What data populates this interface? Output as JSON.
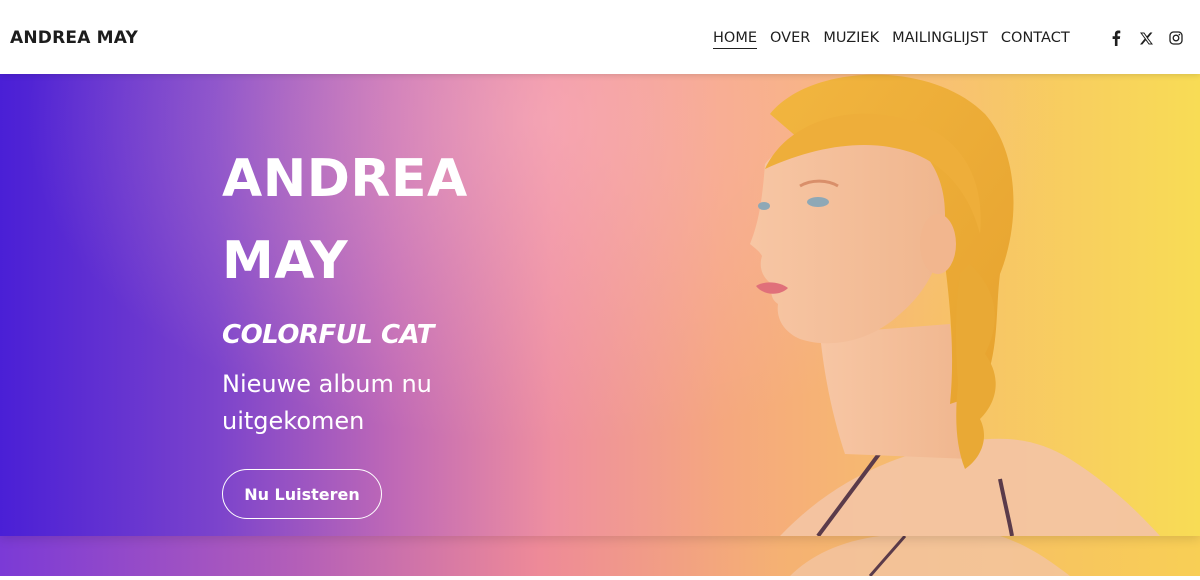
{
  "header": {
    "brand": "ANDREA MAY",
    "nav": [
      {
        "label": "HOME",
        "active": true
      },
      {
        "label": "OVER",
        "active": false
      },
      {
        "label": "MUZIEK",
        "active": false
      },
      {
        "label": "MAILINGLIJST",
        "active": false
      },
      {
        "label": "CONTACT",
        "active": false
      }
    ],
    "social_icons": [
      "facebook-icon",
      "x-icon",
      "instagram-icon"
    ]
  },
  "hero": {
    "title_line1": "ANDREA",
    "title_line2": "MAY",
    "subtitle": "COLORFUL CAT",
    "tagline": "Nieuwe album nu uitgekomen",
    "cta_label": "Nu Luisteren"
  },
  "colors": {
    "gradient_start": "#4a1fd6",
    "gradient_mid": "#ee8fa0",
    "gradient_end": "#f8dc55",
    "text_dark": "#1f1f1f"
  }
}
